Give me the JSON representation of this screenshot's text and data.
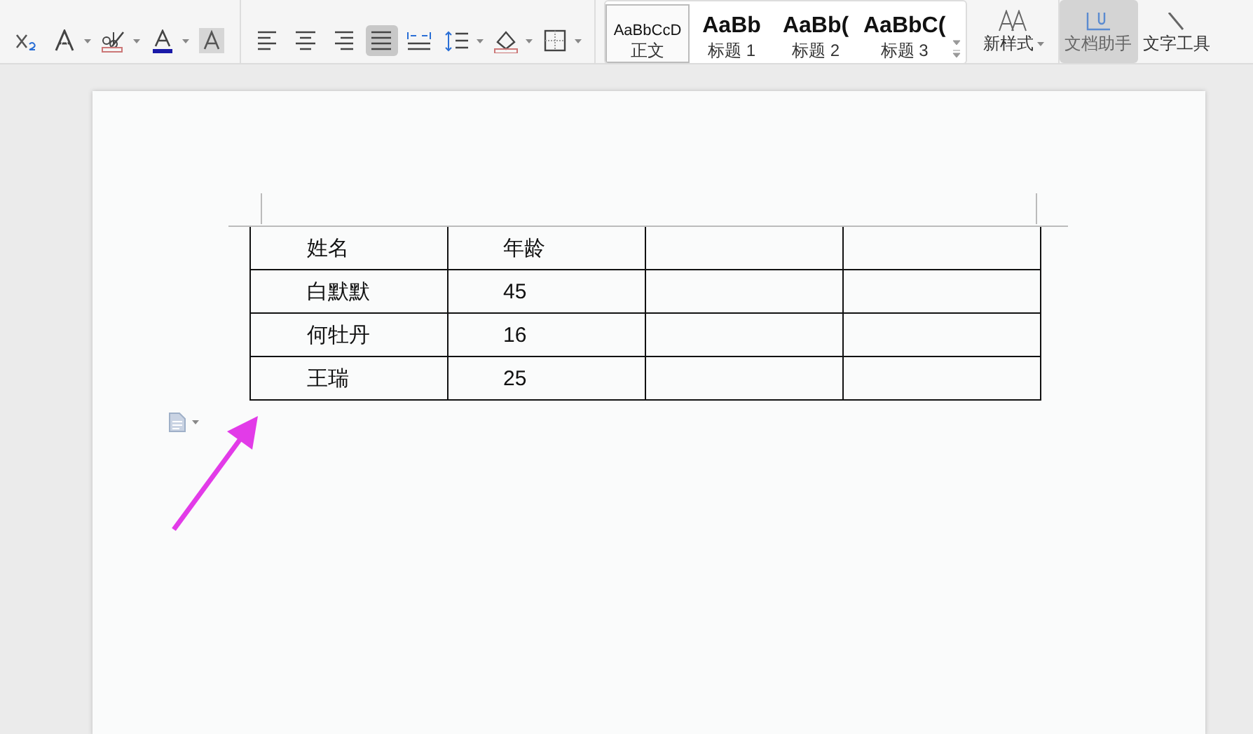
{
  "ribbon": {
    "font_tools": [
      {
        "kind": "subscript",
        "dropdown": false
      },
      {
        "kind": "text-effect",
        "dropdown": true
      },
      {
        "kind": "highlight",
        "dropdown": true
      },
      {
        "kind": "font-color",
        "dropdown": true
      },
      {
        "kind": "char-shading",
        "dropdown": false
      }
    ],
    "paragraph_tools": [
      {
        "kind": "align-left",
        "selected": false,
        "dropdown": false
      },
      {
        "kind": "align-center",
        "selected": false,
        "dropdown": false
      },
      {
        "kind": "align-right",
        "selected": false,
        "dropdown": false
      },
      {
        "kind": "justify",
        "selected": true,
        "dropdown": false
      },
      {
        "kind": "distribute",
        "selected": false,
        "dropdown": false
      },
      {
        "kind": "line-spacing",
        "selected": false,
        "dropdown": true
      },
      {
        "kind": "shading",
        "selected": false,
        "dropdown": true
      },
      {
        "kind": "borders",
        "selected": false,
        "dropdown": true
      }
    ],
    "styles": [
      {
        "preview": "AaBbCcD",
        "label": "正文",
        "selected": true,
        "kind": "normal"
      },
      {
        "preview": "AaBb",
        "label": "标题 1",
        "selected": false,
        "kind": "heading"
      },
      {
        "preview": "AaBb(",
        "label": "标题 2",
        "selected": false,
        "kind": "heading"
      },
      {
        "preview": "AaBbC(",
        "label": "标题 3",
        "selected": false,
        "kind": "heading"
      }
    ],
    "new_style": {
      "label": "新样式"
    },
    "tools": [
      {
        "label": "文档助手",
        "selected": true,
        "kind": "assistant"
      },
      {
        "label": "文字工具",
        "selected": false,
        "kind": "text-tools"
      }
    ]
  },
  "document": {
    "table": {
      "rows": [
        [
          "姓名",
          "年龄"
        ],
        [
          "白默默",
          "45"
        ],
        [
          "何牡丹",
          "16"
        ],
        [
          "王瑞",
          "25"
        ]
      ]
    },
    "paste_options": true,
    "annotation_arrow": true
  }
}
